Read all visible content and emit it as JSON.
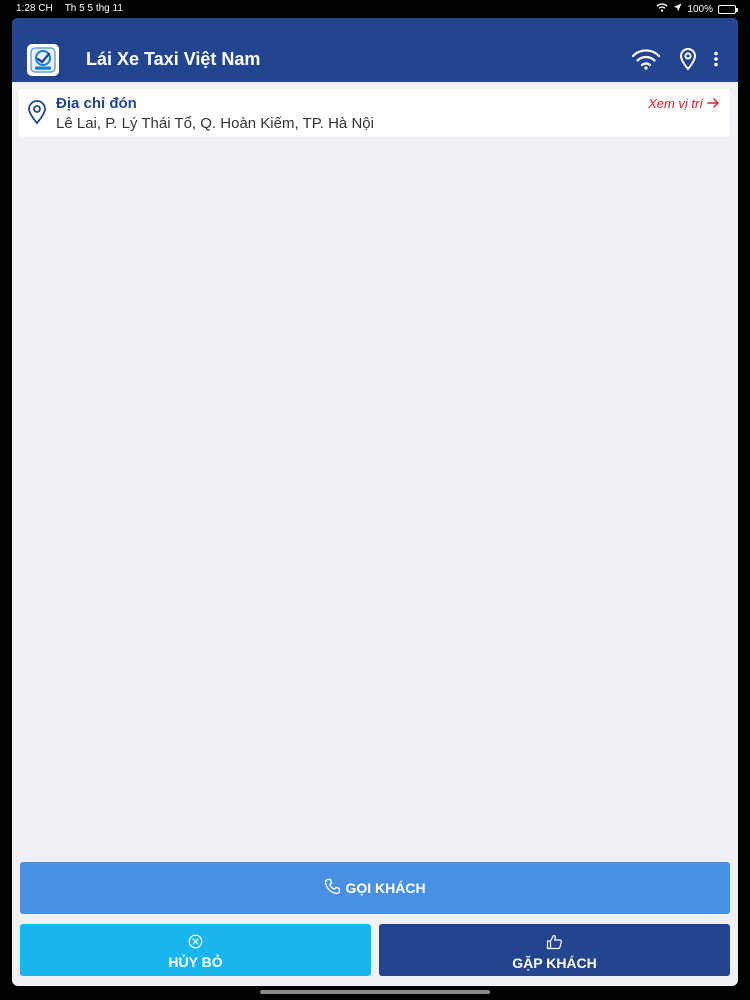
{
  "status_bar": {
    "time": "1:28 CH",
    "date": "Th 5 5 thg 11",
    "battery": "100%"
  },
  "header": {
    "title": "Lái Xe Taxi Việt Nam",
    "icons": [
      "wifi-icon",
      "location-pin-icon",
      "more-vertical-icon"
    ]
  },
  "pickup": {
    "label": "Địa chỉ đón",
    "address": "Lê Lai, P. Lý Thái Tổ, Q. Hoàn Kiếm, TP. Hà Nội",
    "view_location": "Xem vị trí"
  },
  "actions": {
    "call_label": "GỌI KHÁCH",
    "cancel_label": "HỦY BỎ",
    "meet_label": "GẶP KHÁCH"
  },
  "colors": {
    "header": "#234590",
    "call": "#4a90e2",
    "cancel": "#17b6ef",
    "meet": "#234590",
    "link": "#e0202a"
  }
}
